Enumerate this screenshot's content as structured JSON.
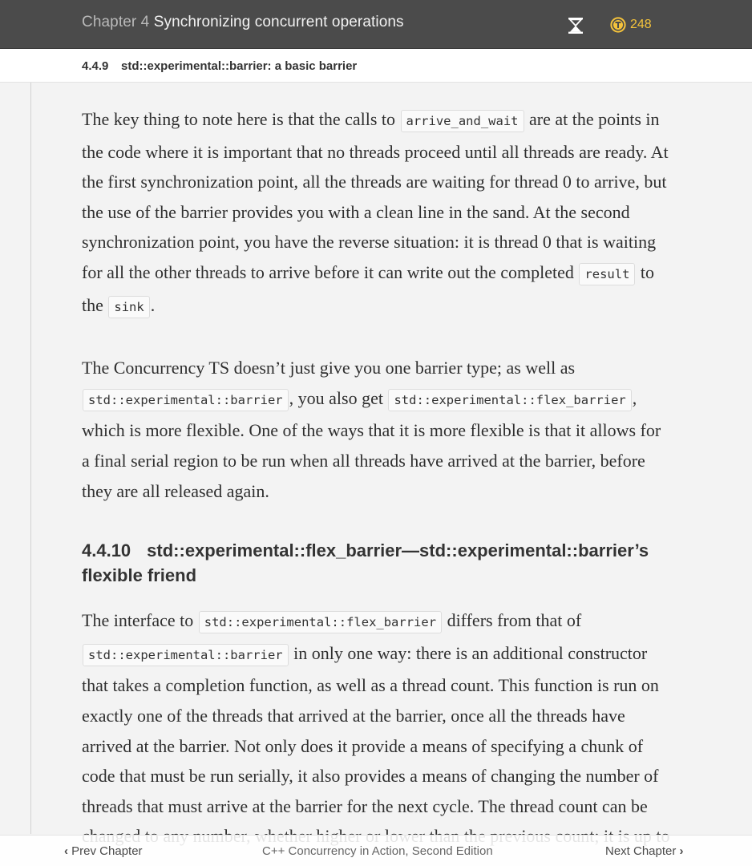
{
  "header": {
    "chapter_prefix": "Chapter 4",
    "chapter_title": "Synchronizing concurrent operations",
    "token_count": "248",
    "icons": {
      "timer": "hourglass-icon",
      "tokens": "token-icon"
    },
    "colors": {
      "bar": "#4b4b4b",
      "token": "#f5c33b"
    }
  },
  "subheader": {
    "section_number": "4.4.9",
    "section_title": "std::experimental::barrier: a basic barrier"
  },
  "content": {
    "p1": {
      "t1": "The key thing to note here is that the calls to",
      "c1": "arrive_and_wait",
      "t2": "are at the points in the code where it is important that no threads proceed until all threads are ready. At the first synchronization point, all the threads are waiting for thread 0 to arrive, but the use of the barrier provides you with a clean line in the sand. At the second synchronization point, you have the reverse situation: it is thread 0 that is waiting for all the other threads to arrive before it can write out the completed",
      "c2": "result",
      "t3": "to the",
      "c3": "sink",
      "t4": "."
    },
    "p2": {
      "t1": "The Concurrency TS doesn’t just give you one barrier type; as well as",
      "c1": "std::experimental::barrier",
      "t2": ", you also get",
      "c2": "std::experimental::flex_barrier",
      "t3": ", which is more flexible. One of the ways that it is more flexible is that it allows for a final serial region to be run when all threads have arrived at the barrier, before they are all released again."
    },
    "section": {
      "number": "4.4.10",
      "title": "std::experimental::flex_barrier—std::experimental::barrier’s flexible friend"
    },
    "p3": {
      "t1": "The interface to",
      "c1": "std::experimental::flex_barrier",
      "t2": "differs from that of",
      "c2": "std::experimental::barrier",
      "t3": "in only one way: there is an additional constructor that takes a completion function, as well as a thread count. This function is run on exactly one of the threads that arrived at the barrier, once all the threads have arrived at the barrier. Not only does it provide a means of specifying a chunk of code that must be run serially, it also provides a means of changing the number of threads that must arrive at the barrier for the next cycle. The thread count can be changed to any number, whether higher or lower than the previous count; it is up to"
    }
  },
  "footer": {
    "prev_label": "Prev Chapter",
    "book_title": "C++ Concurrency in Action, Second Edition",
    "next_label": "Next Chapter"
  }
}
